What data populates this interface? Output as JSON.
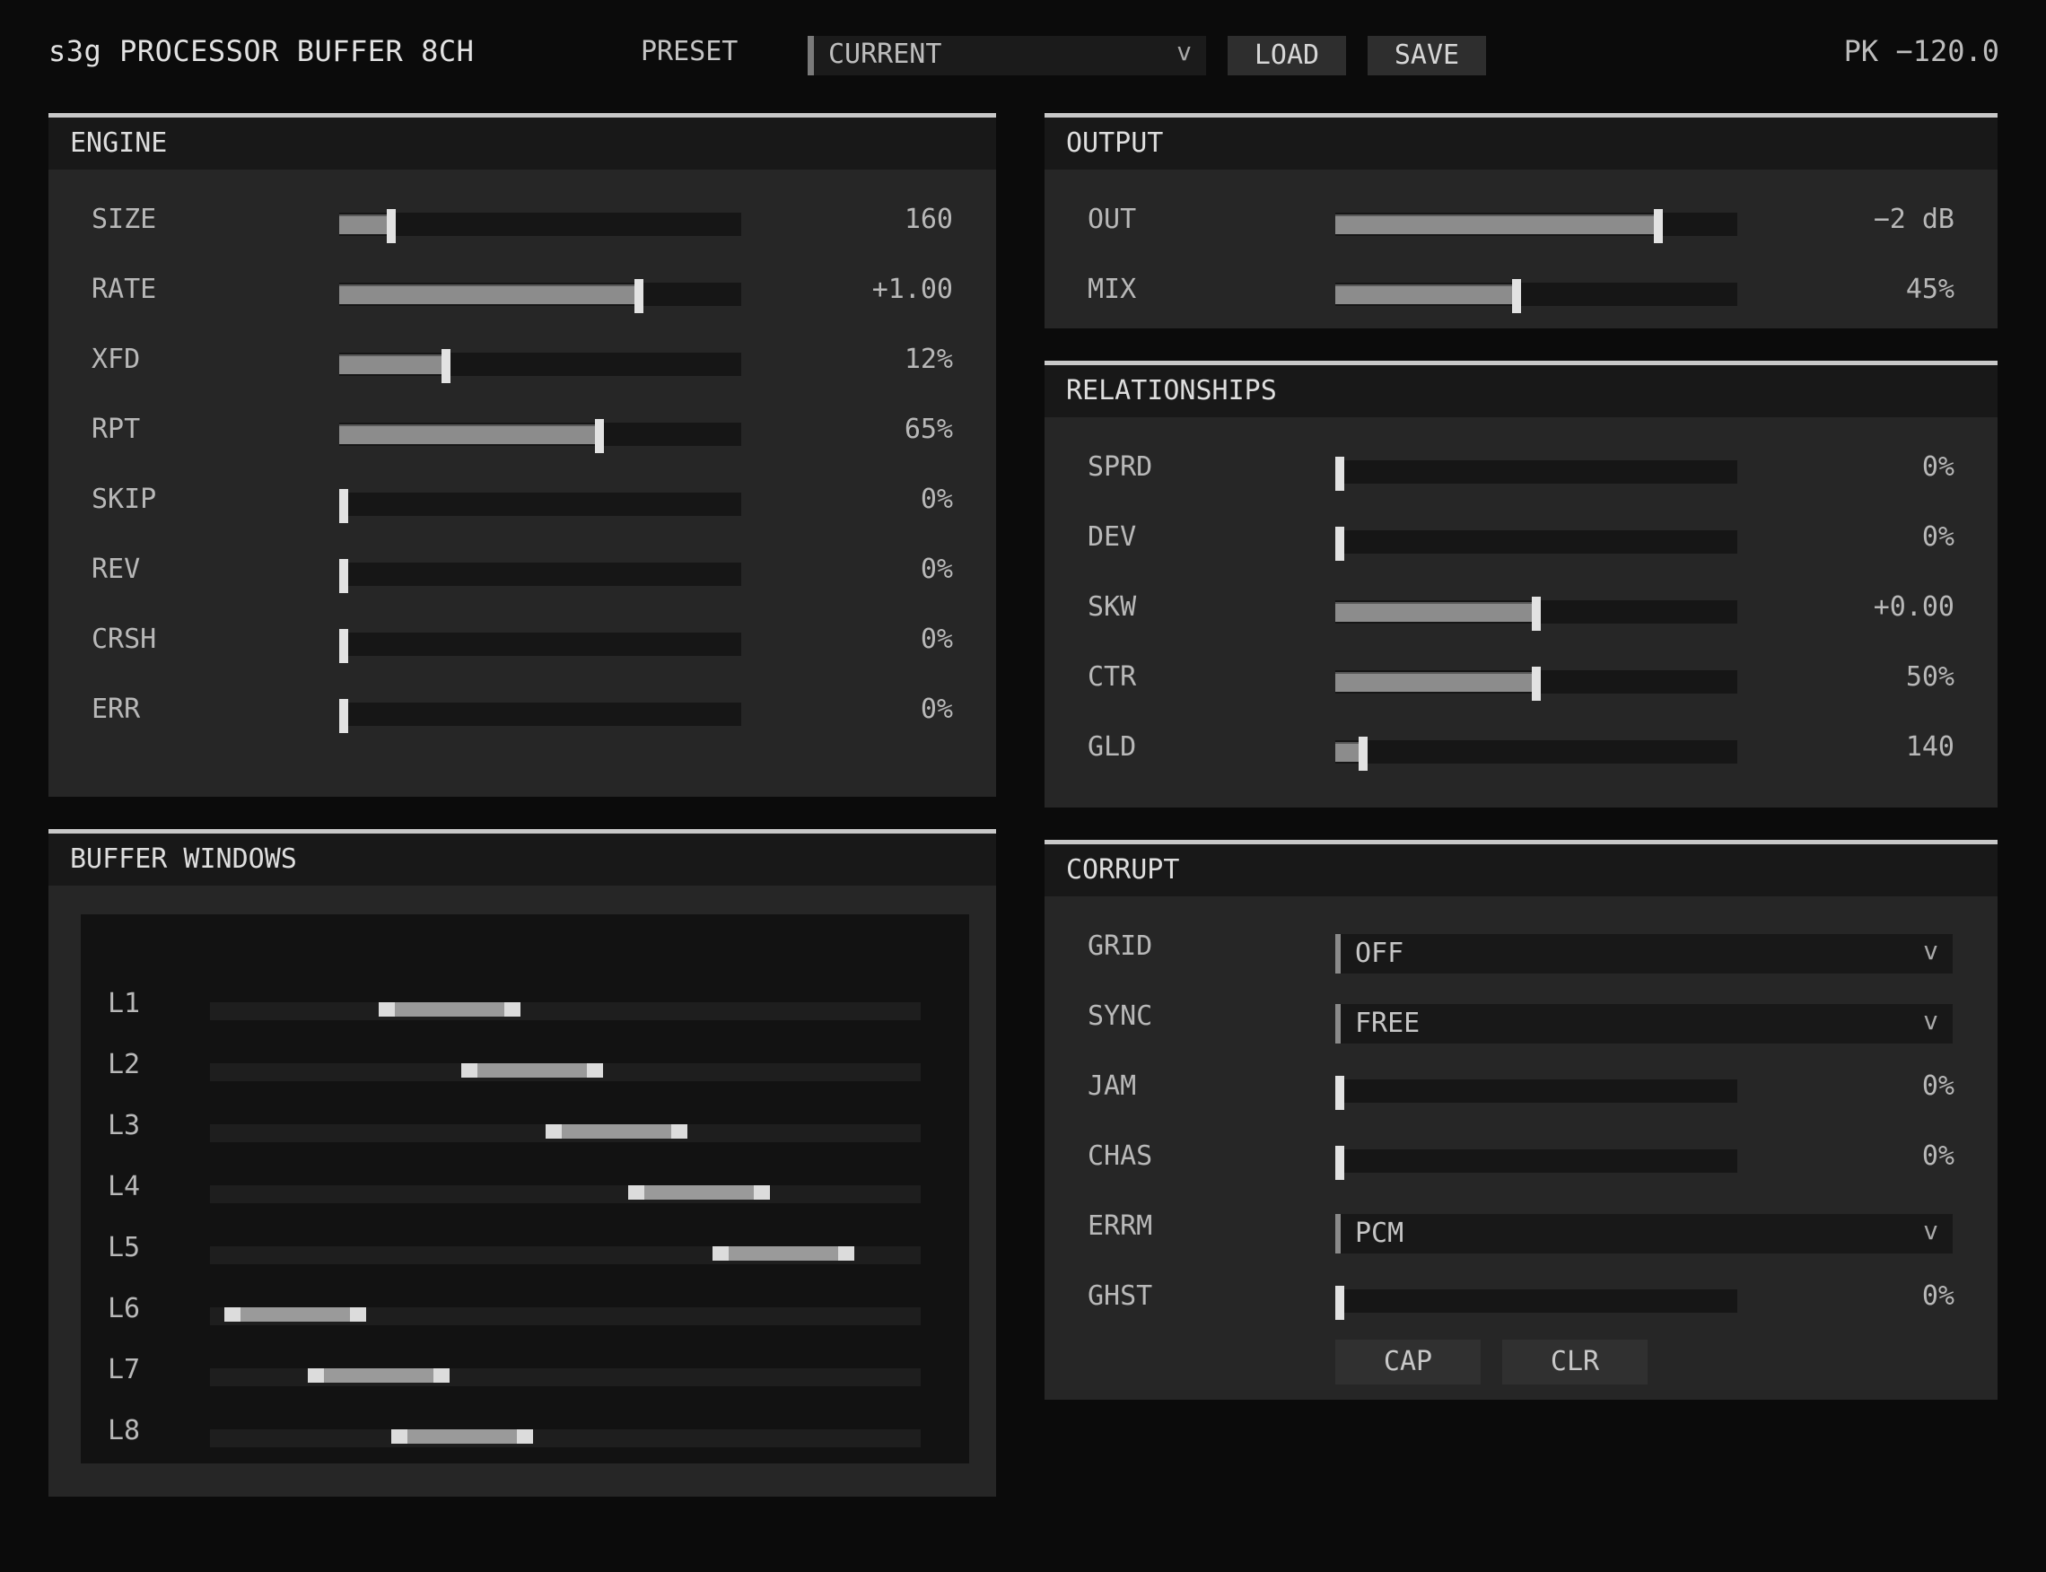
{
  "header": {
    "title": "s3g PROCESSOR BUFFER 8CH",
    "preset_label": "PRESET",
    "preset_value": "CURRENT",
    "load_label": "LOAD",
    "save_label": "SAVE",
    "peak_readout": "PK −120.0"
  },
  "engine": {
    "title": "ENGINE",
    "params": [
      {
        "label": "SIZE",
        "value": "160",
        "level": 0.12
      },
      {
        "label": "RATE",
        "value": "+1.00",
        "level": 0.75
      },
      {
        "label": "XFD",
        "value": "12%",
        "level": 0.26
      },
      {
        "label": "RPT",
        "value": "65%",
        "level": 0.65
      },
      {
        "label": "SKIP",
        "value": "0%",
        "level": 0.0
      },
      {
        "label": "REV",
        "value": "0%",
        "level": 0.0
      },
      {
        "label": "CRSH",
        "value": "0%",
        "level": 0.0
      },
      {
        "label": "ERR",
        "value": "0%",
        "level": 0.0
      }
    ]
  },
  "output": {
    "title": "OUTPUT",
    "params": [
      {
        "label": "OUT",
        "value": "−2 dB",
        "level": 0.81
      },
      {
        "label": "MIX",
        "value": "45%",
        "level": 0.45
      }
    ]
  },
  "relationships": {
    "title": "RELATIONSHIPS",
    "params": [
      {
        "label": "SPRD",
        "value": "0%",
        "level": 0.0
      },
      {
        "label": "DEV",
        "value": "0%",
        "level": 0.0
      },
      {
        "label": "SKW",
        "value": "+0.00",
        "level": 0.5
      },
      {
        "label": "CTR",
        "value": "50%",
        "level": 0.5
      },
      {
        "label": "GLD",
        "value": "140",
        "level": 0.06
      }
    ]
  },
  "buffer_windows": {
    "title": "BUFFER WINDOWS",
    "lanes": [
      {
        "label": "L1",
        "start": 0.237,
        "end": 0.437
      },
      {
        "label": "L2",
        "start": 0.354,
        "end": 0.554
      },
      {
        "label": "L3",
        "start": 0.472,
        "end": 0.672
      },
      {
        "label": "L4",
        "start": 0.589,
        "end": 0.789
      },
      {
        "label": "L5",
        "start": 0.707,
        "end": 0.907
      },
      {
        "label": "L6",
        "start": 0.02,
        "end": 0.22
      },
      {
        "label": "L7",
        "start": 0.137,
        "end": 0.337
      },
      {
        "label": "L8",
        "start": 0.255,
        "end": 0.455
      }
    ]
  },
  "corrupt": {
    "title": "CORRUPT",
    "rows": [
      {
        "label": "GRID",
        "kind": "dropdown",
        "value": "OFF"
      },
      {
        "label": "SYNC",
        "kind": "dropdown",
        "value": "FREE"
      },
      {
        "label": "JAM",
        "kind": "slider",
        "value": "0%",
        "level": 0.0
      },
      {
        "label": "CHAS",
        "kind": "slider",
        "value": "0%",
        "level": 0.0
      },
      {
        "label": "ERRM",
        "kind": "dropdown",
        "value": "PCM"
      },
      {
        "label": "GHST",
        "kind": "slider",
        "value": "0%",
        "level": 0.0
      }
    ],
    "cap_label": "CAP",
    "clr_label": "CLR"
  },
  "dropdown_chevron": "v",
  "colors": {
    "background": "#0b0b0b",
    "panel": "#262626",
    "panel_header": "#181818",
    "accent_line": "#c8c8c8",
    "slider_fill": "#8c8c8c",
    "slider_thumb": "#e2e2e2"
  }
}
